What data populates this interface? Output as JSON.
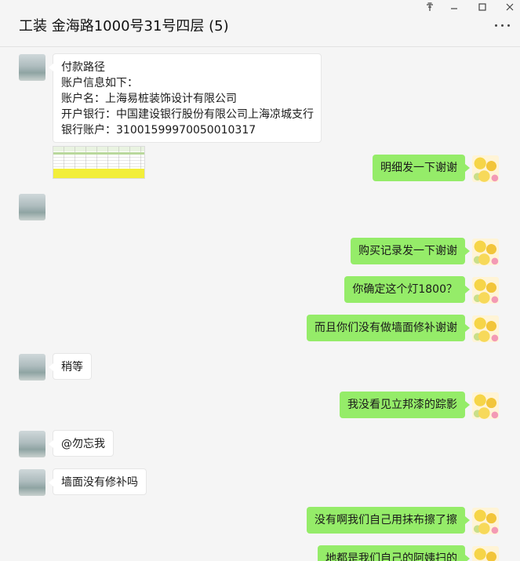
{
  "window": {
    "title": "工装 金海路1000号31号四层 (5)",
    "controls": {
      "pin": "pin-icon",
      "minimize": "minimize-icon",
      "maximize": "maximize-icon",
      "close": "close-icon"
    },
    "more_icon": "more-dots-icon"
  },
  "colors": {
    "outgoing_bubble": "#95ec69",
    "incoming_bubble": "#ffffff",
    "background": "#f5f5f5"
  },
  "messages": [
    {
      "side": "in",
      "lines": [
        "付款路径",
        "账户信息如下：",
        "账户名：上海易桩装饰设计有限公司",
        "开户银行：中国建设银行股份有限公司上海凉城支行",
        "银行账户：31001599970050010317"
      ]
    },
    {
      "side": "out",
      "text": "明细发一下谢谢"
    },
    {
      "side": "in",
      "type": "image",
      "alt": "spreadsheet-image"
    },
    {
      "side": "out",
      "text": "购买记录发一下谢谢"
    },
    {
      "side": "out",
      "text": "你确定这个灯1800？"
    },
    {
      "side": "out",
      "text": "而且你们没有做墙面修补谢谢"
    },
    {
      "side": "in",
      "text": "稍等"
    },
    {
      "side": "out",
      "text": "我没看见立邦漆的踪影"
    },
    {
      "side": "in",
      "text": "@勿忘我"
    },
    {
      "side": "in",
      "text": "墙面没有修补吗"
    },
    {
      "side": "out",
      "text": "没有啊我们自己用抹布擦了擦"
    },
    {
      "side": "out",
      "text": "地都是我们自己的阿姨扫的"
    }
  ]
}
